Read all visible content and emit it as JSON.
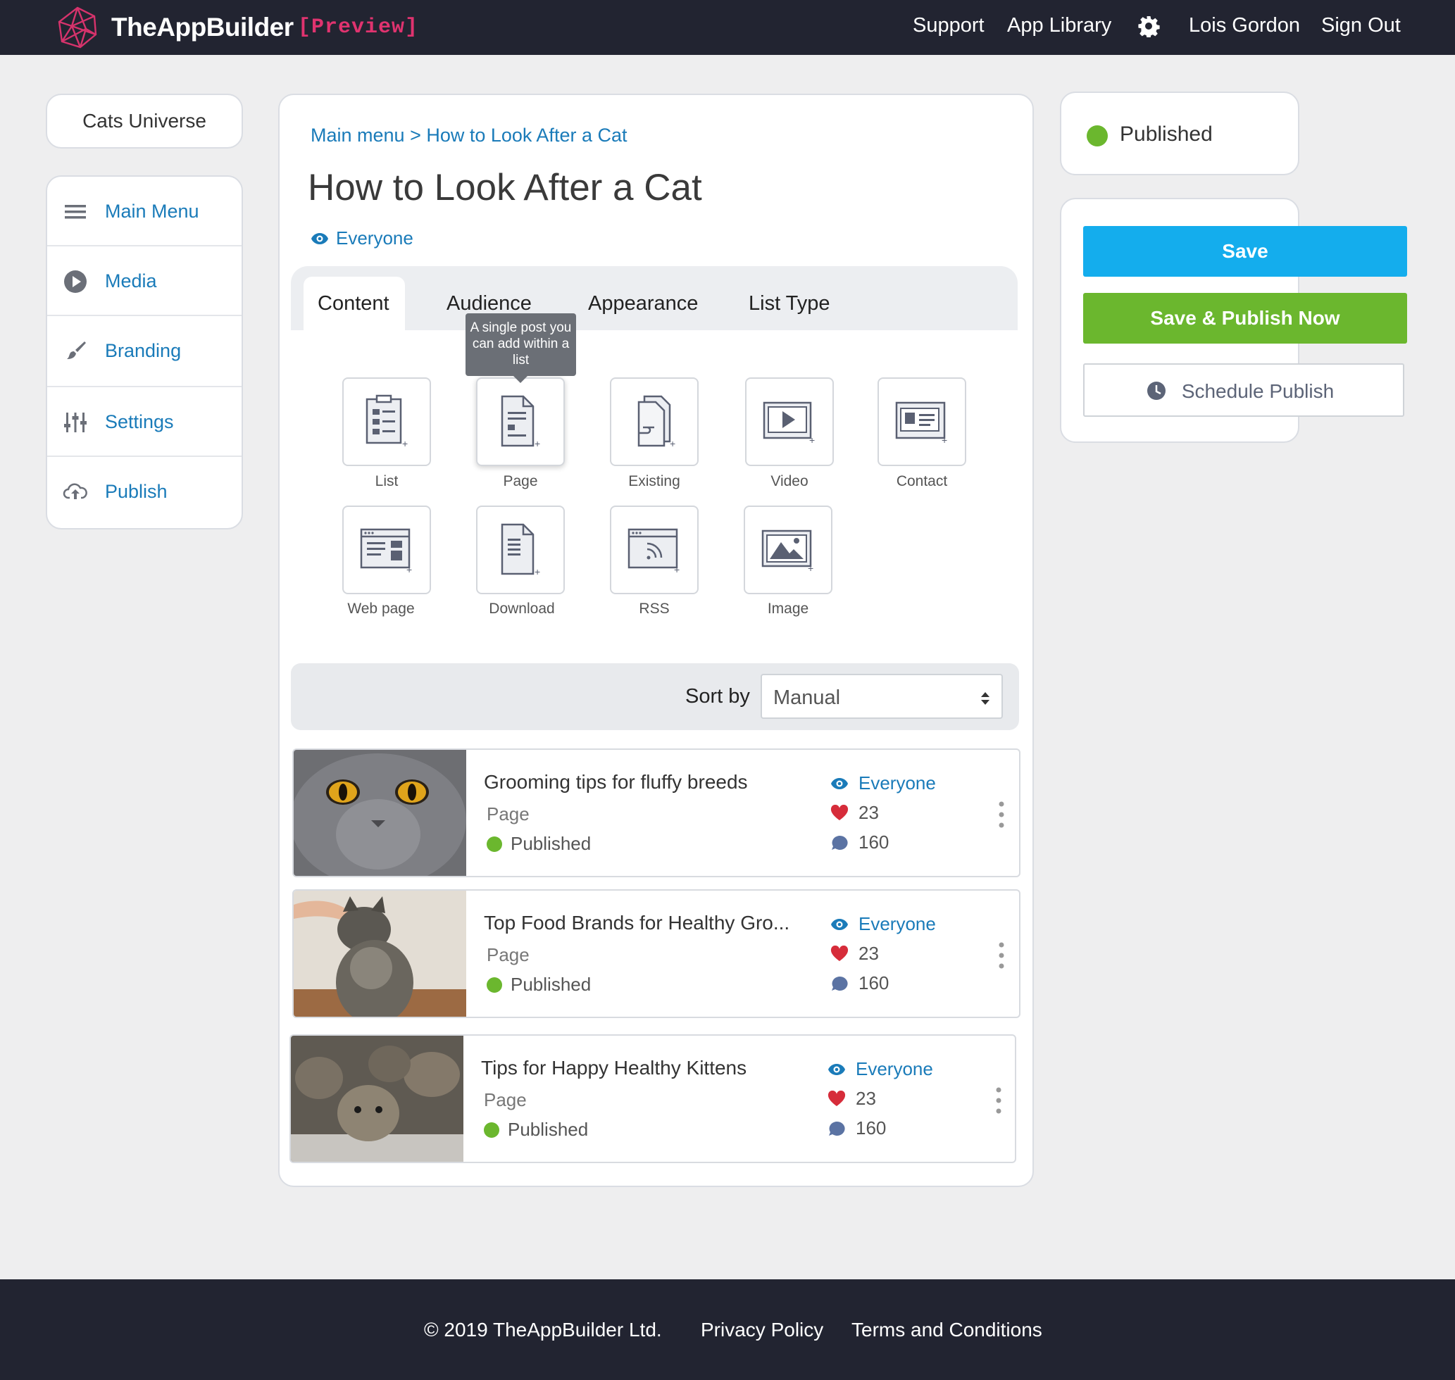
{
  "header": {
    "logo_text": "TheAppBuilder",
    "logo_tag": "[Preview]",
    "nav": [
      "Support",
      "App Library"
    ],
    "settings_icon": "gear-icon",
    "user_name": "Lois Gordon",
    "sign_out": "Sign Out"
  },
  "sidebar": {
    "app_name": "Cats Universe",
    "items": [
      {
        "label": "Main Menu",
        "icon": "hamburger-icon"
      },
      {
        "label": "Media",
        "icon": "play-icon"
      },
      {
        "label": "Branding",
        "icon": "brush-icon"
      },
      {
        "label": "Settings",
        "icon": "sliders-icon"
      },
      {
        "label": "Publish",
        "icon": "cloud-upload-icon"
      }
    ]
  },
  "main": {
    "breadcrumb": "Main menu > How to Look After a Cat",
    "title": "How to Look After a Cat",
    "audience": "Everyone",
    "tabs": [
      "Content",
      "Audience",
      "Appearance",
      "List Type"
    ],
    "tooltip": "A single post you can add within a list",
    "content_types": [
      "List",
      "Page",
      "Existing",
      "Video",
      "Contact",
      "Web page",
      "Download",
      "RSS",
      "Image"
    ],
    "sort_label": "Sort by",
    "sort_value": "Manual",
    "items": [
      {
        "title": "Grooming tips for fluffy breeds",
        "type": "Page",
        "status": "Published",
        "audience": "Everyone",
        "likes": "23",
        "comments": "160"
      },
      {
        "title": "Top Food Brands for Healthy Gro...",
        "type": "Page",
        "status": "Published",
        "audience": "Everyone",
        "likes": "23",
        "comments": "160"
      },
      {
        "title": "Tips for Happy Healthy Kittens",
        "type": "Page",
        "status": "Published",
        "audience": "Everyone",
        "likes": "23",
        "comments": "160"
      }
    ]
  },
  "status_panel": {
    "status": "Published",
    "save": "Save",
    "save_publish": "Save & Publish Now",
    "schedule": "Schedule Publish"
  },
  "footer": {
    "copyright": "© 2019 TheAppBuilder Ltd.",
    "privacy": "Privacy Policy",
    "terms": "Terms and Conditions"
  },
  "colors": {
    "header_bg": "#222431",
    "link_blue": "#1a7bb9",
    "save_blue": "#14aded",
    "publish_green": "#6bb72e",
    "brand_pink": "#e0336f"
  }
}
